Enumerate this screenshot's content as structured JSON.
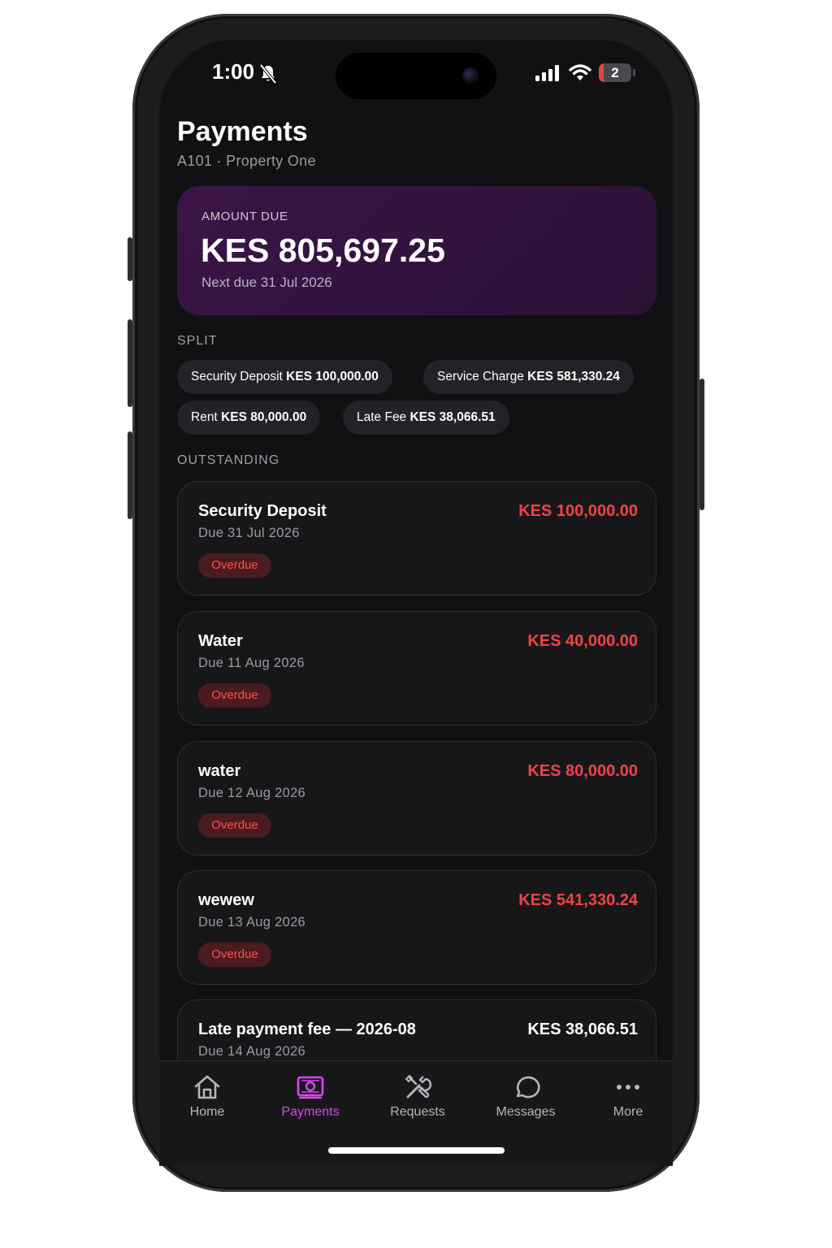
{
  "status_bar": {
    "time": "1:00",
    "battery_level": "2"
  },
  "header": {
    "title": "Payments",
    "subtitle": "A101 · Property One"
  },
  "amount_due": {
    "label": "AMOUNT DUE",
    "value": "KES 805,697.25",
    "next_due": "Next due 31 Jul 2026"
  },
  "split": {
    "label": "SPLIT",
    "chips": [
      {
        "name": "Security Deposit",
        "amount": "KES 100,000.00"
      },
      {
        "name": "Service Charge",
        "amount": "KES 581,330.24"
      },
      {
        "name": "Rent",
        "amount": "KES 80,000.00"
      },
      {
        "name": "Late Fee",
        "amount": "KES 38,066.51"
      }
    ]
  },
  "outstanding": {
    "label": "OUTSTANDING",
    "items": [
      {
        "title": "Security Deposit",
        "due": "Due 31 Jul 2026",
        "amount": "KES 100,000.00",
        "status": "Overdue"
      },
      {
        "title": "Water",
        "due": "Due 11 Aug 2026",
        "amount": "KES 40,000.00",
        "status": "Overdue"
      },
      {
        "title": "water",
        "due": "Due 12 Aug 2026",
        "amount": "KES 80,000.00",
        "status": "Overdue"
      },
      {
        "title": "wewew",
        "due": "Due 13 Aug 2026",
        "amount": "KES 541,330.24",
        "status": "Overdue"
      },
      {
        "title": "Late payment fee — 2026-08",
        "due": "Due 14 Aug 2026",
        "amount": "KES 38,066.51"
      }
    ]
  },
  "tab_bar": {
    "tabs": [
      {
        "label": "Home",
        "icon": "home-icon"
      },
      {
        "label": "Payments",
        "icon": "payments-icon",
        "active": true
      },
      {
        "label": "Requests",
        "icon": "tools-icon"
      },
      {
        "label": "Messages",
        "icon": "chat-icon"
      },
      {
        "label": "More",
        "icon": "more-icon"
      }
    ]
  },
  "colors": {
    "accent": "#d946ef",
    "overdue": "#ef4444",
    "card_gradient": "#3b1448",
    "background": "#111113"
  }
}
